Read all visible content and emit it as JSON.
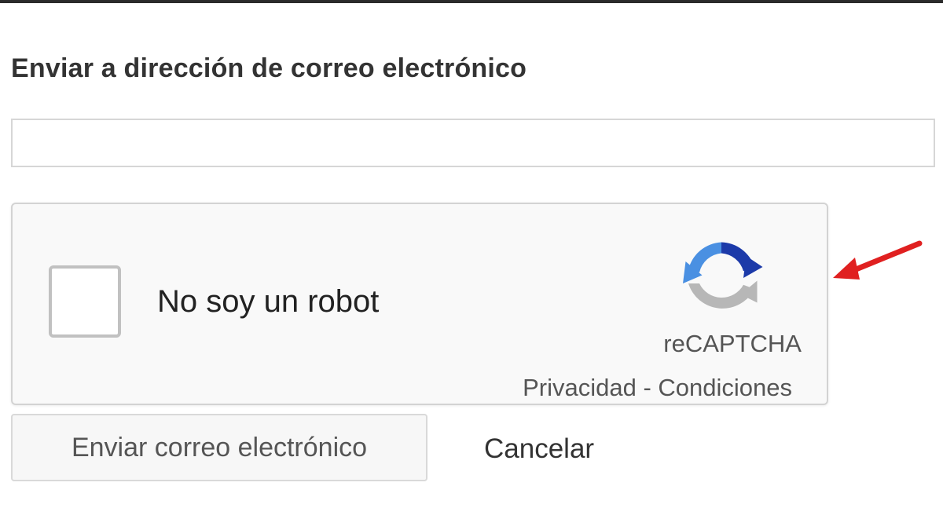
{
  "form": {
    "title": "Enviar a dirección de correo electrónico",
    "email_value": "",
    "email_placeholder": ""
  },
  "captcha": {
    "checkbox_label": "No soy un robot",
    "checked": false,
    "brand": "reCAPTCHA",
    "privacy_label": "Privacidad",
    "separator": " - ",
    "terms_label": "Condiciones",
    "icon": "recaptcha-logo-icon"
  },
  "actions": {
    "send_label": "Enviar correo electrónico",
    "cancel_label": "Cancelar"
  },
  "annotation": {
    "icon": "red-arrow-icon",
    "color": "#e02020"
  },
  "colors": {
    "recaptcha_blue": "#4a90e2",
    "recaptcha_dark_blue": "#1c3aa9",
    "recaptcha_gray": "#b7b7b7"
  }
}
